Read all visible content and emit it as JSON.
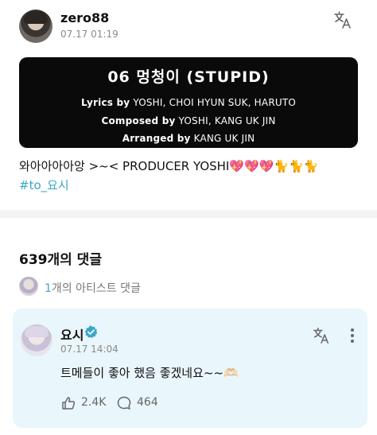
{
  "post": {
    "username": "zero88",
    "timestamp": "07.17 01:19",
    "text": "와아아아아앙 >~< PRODUCER YOSHI💖💖💖🐈🐈🐈",
    "hashtag": "#to_요시"
  },
  "banner": {
    "title": "06 멍청이 (STUPID)",
    "lyrics_label": "Lyrics by",
    "lyrics_names": "YOSHI, CHOI HYUN SUK, HARUTO",
    "composed_label": "Composed by",
    "composed_names": "YOSHI, KANG UK JIN",
    "arranged_label": "Arranged by",
    "arranged_names": "KANG UK JIN"
  },
  "comments": {
    "heading": "639개의 댓글",
    "artist_count": "1",
    "artist_label": "개의 아티스트 댓글"
  },
  "artist_comment": {
    "name": "요시",
    "timestamp": "07.17 14:04",
    "text": "트메들이 좋아 했음 좋겠네요~~🫶🏻",
    "likes": "2.4K",
    "replies": "464"
  },
  "icons": {
    "translate": "translate-icon",
    "verified": "verified-icon",
    "more": "more-vertical-icon",
    "like": "like-icon",
    "reply": "comment-icon"
  },
  "colors": {
    "accent": "#3aa7c9",
    "card_bg": "#e9f6fb",
    "banner_bg": "#0a0a0a"
  }
}
